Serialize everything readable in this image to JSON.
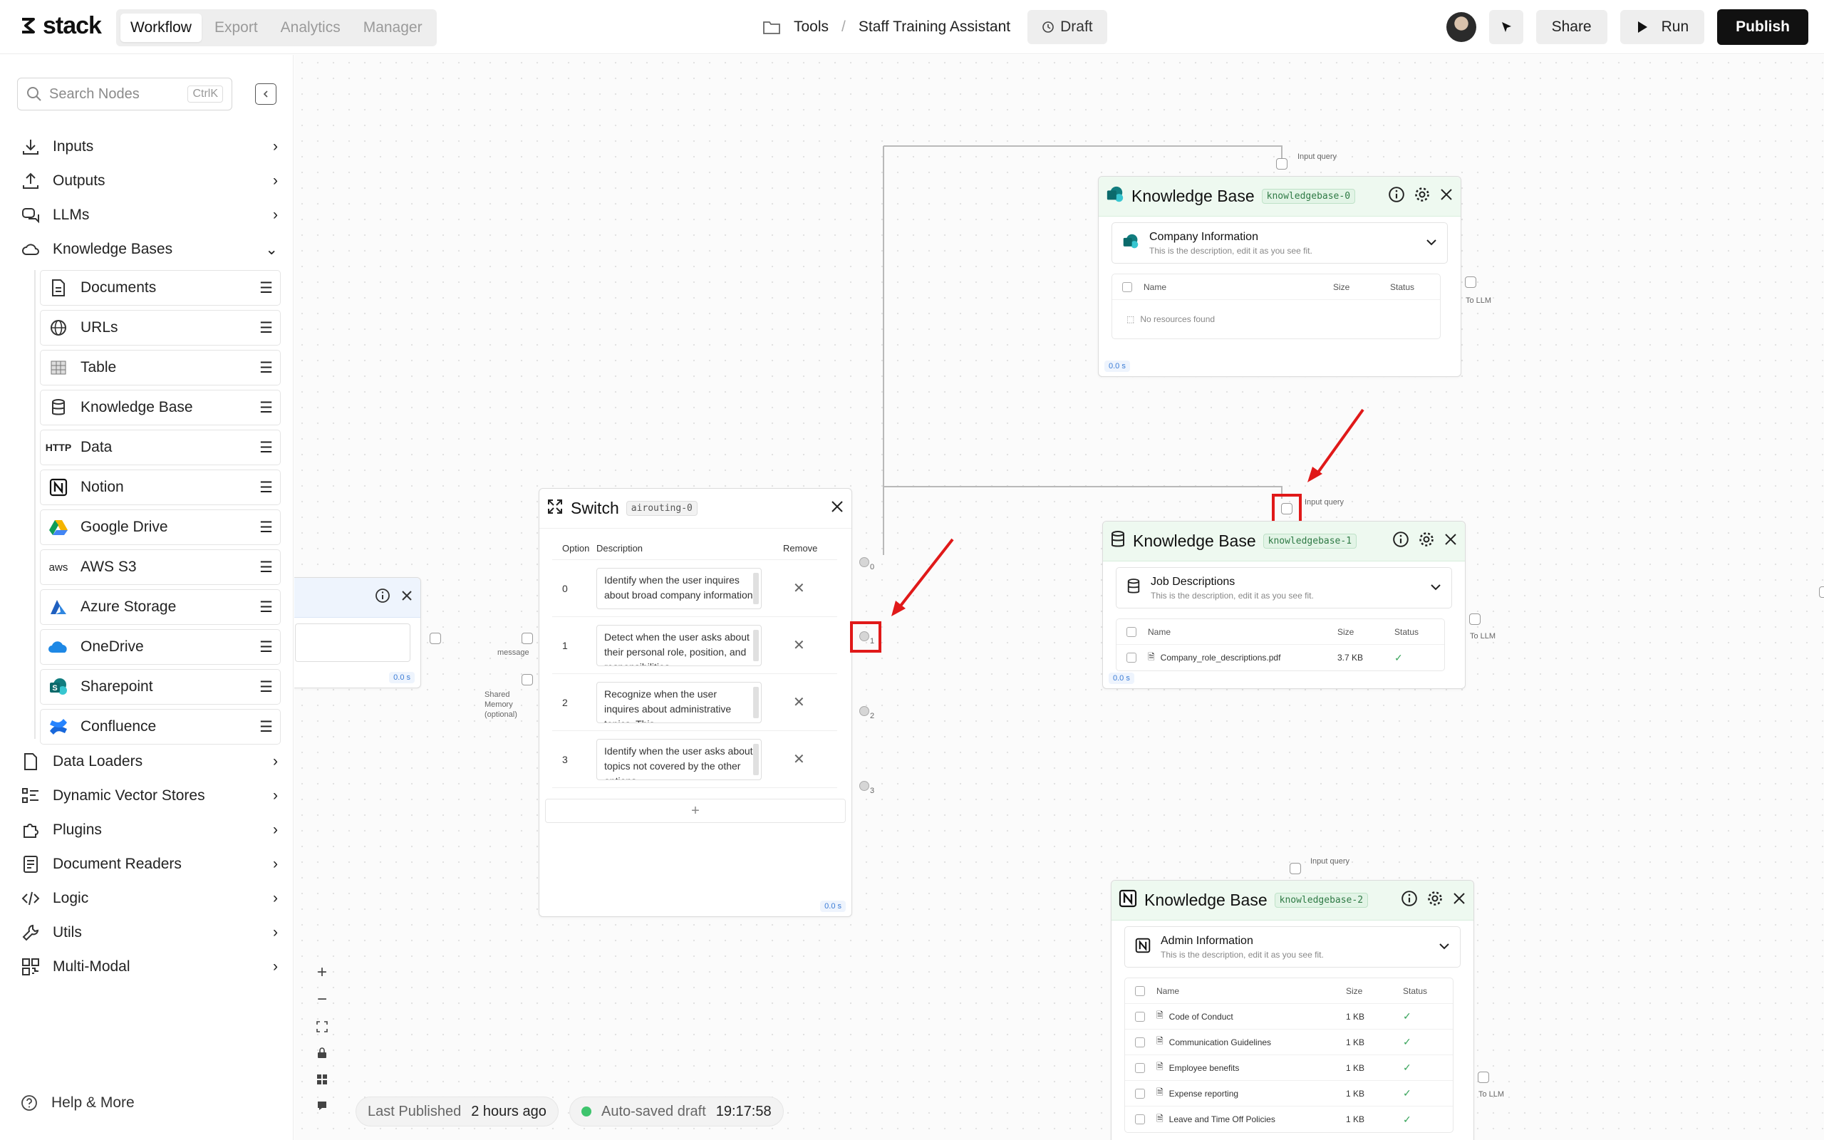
{
  "app": {
    "logo_text": "stack"
  },
  "nav": {
    "tabs": [
      "Workflow",
      "Export",
      "Analytics",
      "Manager"
    ],
    "active": "Workflow"
  },
  "breadcrumb": {
    "folder": "Tools",
    "project": "Staff Training Assistant",
    "draft_label": "Draft"
  },
  "toolbar": {
    "share": "Share",
    "run": "Run",
    "publish": "Publish"
  },
  "sidebar": {
    "search_placeholder": "Search Nodes",
    "search_shortcut": "CtrlK",
    "categories_top": [
      "Inputs",
      "Outputs",
      "LLMs",
      "Knowledge Bases"
    ],
    "kb_items": [
      "Documents",
      "URLs",
      "Table",
      "Knowledge Base",
      "Data",
      "Notion",
      "Google Drive",
      "AWS S3",
      "Azure Storage",
      "OneDrive",
      "Sharepoint",
      "Confluence"
    ],
    "kb_icon_text": {
      "data": "HTTP",
      "aws": "aws"
    },
    "categories_bottom": [
      "Data Loaders",
      "Dynamic Vector Stores",
      "Plugins",
      "Document Readers",
      "Logic",
      "Utils",
      "Multi-Modal"
    ],
    "help": "Help & More"
  },
  "canvas": {
    "status": {
      "published_label": "Last Published",
      "published_value": "2 hours ago",
      "autosave_label": "Auto-saved draft",
      "autosave_value": "19:17:58"
    },
    "left_node": {
      "time": "0.0 s",
      "port_message": "message",
      "port_memory": "Shared Memory (optional)"
    },
    "switch": {
      "title": "Switch",
      "tag": "airouting-0",
      "headers": {
        "option": "Option",
        "description": "Description",
        "remove": "Remove"
      },
      "rows": [
        {
          "option": "0",
          "description": "Identify when the user inquires about broad company information"
        },
        {
          "option": "1",
          "description": "Detect when the user asks about their personal role, position, and responsibilities"
        },
        {
          "option": "2",
          "description": "Recognize when the user inquires about administrative topics. This"
        },
        {
          "option": "3",
          "description": "Identify when the user asks about topics not covered by the other options"
        }
      ],
      "add_label": "+",
      "time": "0.0 s",
      "output_ports": [
        "0",
        "1",
        "2",
        "3"
      ]
    },
    "kb0": {
      "title": "Knowledge Base",
      "tag": "knowledgebase-0",
      "selected": "Company Information",
      "subtitle": "This is the description, edit it as you see fit.",
      "headers": {
        "name": "Name",
        "size": "Size",
        "status": "Status"
      },
      "empty": "No resources found",
      "time": "0.0 s",
      "input_label": "Input query",
      "output_label": "To LLM"
    },
    "kb1": {
      "title": "Knowledge Base",
      "tag": "knowledgebase-1",
      "selected": "Job Descriptions",
      "subtitle": "This is the description, edit it as you see fit.",
      "headers": {
        "name": "Name",
        "size": "Size",
        "status": "Status"
      },
      "files": [
        {
          "name": "Company_role_descriptions.pdf",
          "size": "3.7 KB",
          "status": "✓"
        }
      ],
      "time": "0.0 s",
      "input_label": "Input query",
      "output_label": "To LLM"
    },
    "kb2": {
      "title": "Knowledge Base",
      "tag": "knowledgebase-2",
      "selected": "Admin Information",
      "subtitle": "This is the description, edit it as you see fit.",
      "headers": {
        "name": "Name",
        "size": "Size",
        "status": "Status"
      },
      "files": [
        {
          "name": "Code of Conduct",
          "size": "1 KB",
          "status": "✓"
        },
        {
          "name": "Communication Guidelines",
          "size": "1 KB",
          "status": "✓"
        },
        {
          "name": "Employee benefits",
          "size": "1 KB",
          "status": "✓"
        },
        {
          "name": "Expense reporting",
          "size": "1 KB",
          "status": "✓"
        },
        {
          "name": "Leave and Time Off Policies",
          "size": "1 KB",
          "status": "✓"
        }
      ],
      "input_label": "Input query",
      "output_label": "To LLM"
    }
  },
  "colors": {
    "accent_green": "#eef9f0",
    "annotation_red": "#e01919",
    "publish_bg": "#111111"
  }
}
